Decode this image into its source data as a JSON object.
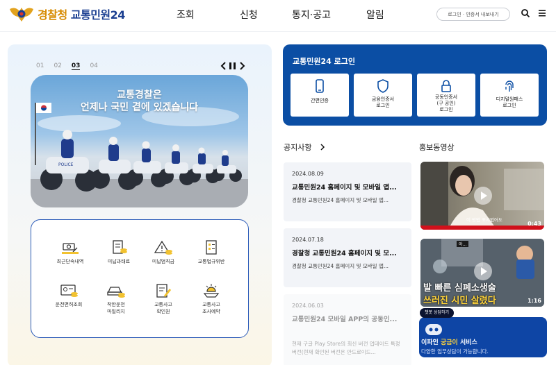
{
  "header": {
    "logo_part1": "경찰청",
    "logo_part2": "교통민원24",
    "nav": [
      "조회",
      "신청",
      "통지·공고",
      "알림"
    ],
    "login_link": "로그인 · 인증서 내보내기"
  },
  "slider": {
    "numbers": [
      "01",
      "02",
      "03",
      "04"
    ],
    "active_index": 2,
    "banner_line1": "교통경찰은",
    "banner_line2": "언제나 국민 곁에 있겠습니다"
  },
  "quick_menu": [
    {
      "label": "최근단속내역",
      "icon": "camera-car-icon"
    },
    {
      "label": "미납과태료",
      "icon": "document-coins-icon"
    },
    {
      "label": "미납범칙금",
      "icon": "warning-coins-icon"
    },
    {
      "label": "교통법규위반",
      "icon": "checklist-icon"
    },
    {
      "label": "운전면허조회",
      "icon": "license-card-icon"
    },
    {
      "label": "착한운전\n마일리지",
      "icon": "car-coins-icon"
    },
    {
      "label": "교통사고\n확인원",
      "icon": "document-pen-icon"
    },
    {
      "label": "교통사고\n조사예약",
      "icon": "siren-hand-icon"
    }
  ],
  "login": {
    "title": "교통민원24 로그인",
    "options": [
      {
        "label": "간편인증",
        "icon": "phone-icon"
      },
      {
        "label": "금융인증서\n로그인",
        "icon": "shield-icon"
      },
      {
        "label": "공동인증서\n(구 공인)\n로그인",
        "icon": "lock-icon"
      },
      {
        "label": "디지털원패스\n로그인",
        "icon": "fingerprint-icon"
      }
    ]
  },
  "notices": {
    "title": "공지사항",
    "items": [
      {
        "date": "2024.08.09",
        "title": "교통민원24 홈페이지 및 모바일 앱...",
        "desc": "경찰청 교통민원24 홈페이지 및 모바일 앱..."
      },
      {
        "date": "2024.07.18",
        "title": "경찰청 교통민원24 홈페이지 및 모...",
        "desc": "경찰청 교통민원24 홈페이지 및 모바일 앱..."
      },
      {
        "date": "2024.06.03",
        "title": "교통민원24 모바일 APP의 공동인...",
        "desc": "현재 구글 Play Store의 최신 버전 업데이트 특정 버전(현재 확인된 버전은 안드로이드..."
      }
    ]
  },
  "videos": {
    "title": "홍보동영상",
    "items": [
      {
        "duration": "0:43",
        "caption": "이 방법 표시없어도"
      },
      {
        "duration": "1:16",
        "caption_line1": "발 빠른 심폐소생술",
        "caption_line2": "쓰러진 시민 살렸다",
        "overlay": "아..."
      }
    ]
  },
  "chatbot": {
    "bubble": "챗봇 상담하기",
    "main_prefix": "이파인 ",
    "main_highlight": "궁금이",
    "main_suffix": " 서비스",
    "sub": "다양한 업무상담이 가능합니다."
  },
  "colors": {
    "brand_navy": "#1b3f91",
    "login_blue": "#0b4ea4",
    "quick_border": "#2a5ab8",
    "highlight_yellow": "#ffd43b"
  }
}
